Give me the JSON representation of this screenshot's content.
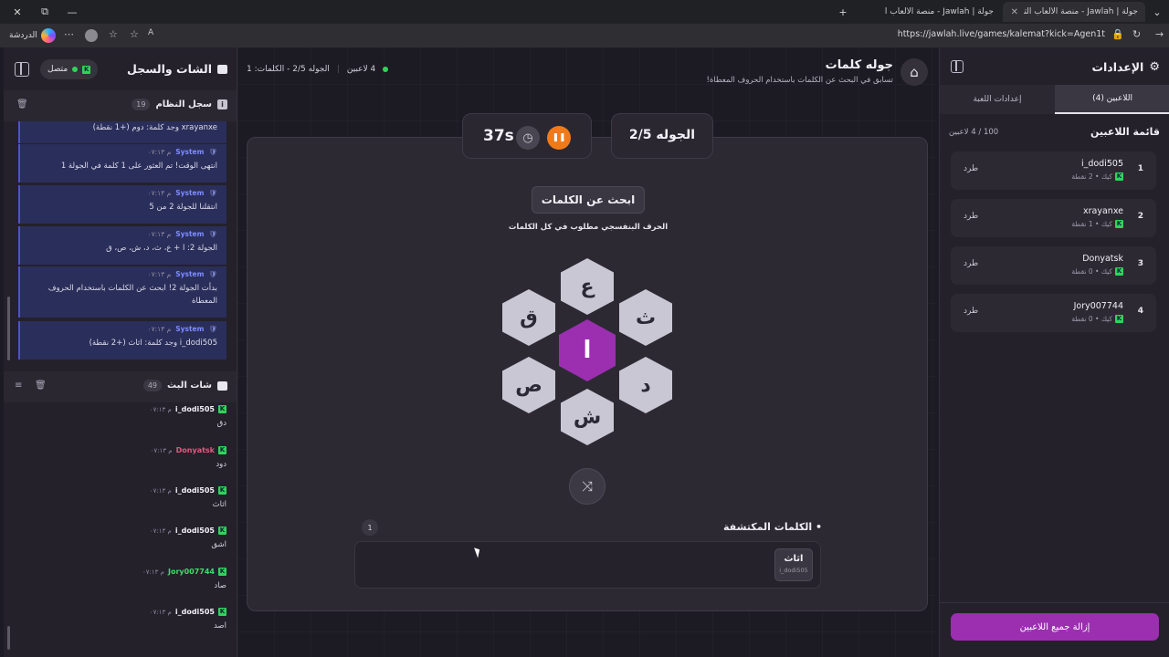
{
  "browser": {
    "tabs": [
      {
        "label": "جولة | Jawlah - منصة الألعاب التفاعلية",
        "active": true
      },
      {
        "label": "جولة | Jawlah - منصة الألعاب التفاعلية",
        "active": false
      }
    ],
    "copilot_label": "الدردشة",
    "url": "https://jawlah.live/games/kalemat?kick=Agen1t"
  },
  "chat_panel": {
    "title": "الشات والسجل",
    "status_label": "متصل",
    "system_log": {
      "title": "سجل النظام",
      "count": "19",
      "first_partial": "xrayanxe وجد كلمة: دوم (+1 نقطة)",
      "messages": [
        {
          "sender": "System",
          "time": "م ٠٧:١٣",
          "text": "انتهى الوقت! تم العثور على 1 كلمة في الجولة 1"
        },
        {
          "sender": "System",
          "time": "م ٠٧:١٣",
          "text": "انتقلنا للجولة 2 من 5"
        },
        {
          "sender": "System",
          "time": "م ٠٧:١٣",
          "text": "الجولة 2: ا + ع، ث، د، ش، ص، ق"
        },
        {
          "sender": "System",
          "time": "م ٠٧:١٣",
          "text": "بدأت الجولة 2! ابحث عن الكلمات باستخدام الحروف المعطاة"
        },
        {
          "sender": "System",
          "time": "م ٠٧:١٣",
          "text": "i_dodi505 وجد كلمة: اثاث (+2 نقطة)"
        }
      ]
    },
    "live_chat": {
      "title": "شات البث",
      "count": "49",
      "messages": [
        {
          "user": "i_dodi505",
          "time": "م ٠٧:١٣",
          "text": "دق",
          "color": "#f0eef6"
        },
        {
          "user": "Donyatsk",
          "time": "م ٠٧:١٣",
          "text": "دود",
          "color": "#e4587e"
        },
        {
          "user": "i_dodi505",
          "time": "م ٠٧:١٣",
          "text": "اثاث",
          "color": "#f0eef6"
        },
        {
          "user": "i_dodi505",
          "time": "م ٠٧:١٣",
          "text": "اشق",
          "color": "#f0eef6"
        },
        {
          "user": "Jory007744",
          "time": "م ٠٧:١٣",
          "text": "صاد",
          "color": "#3ddc6a"
        },
        {
          "user": "i_dodi505",
          "time": "م ٠٧:١٣",
          "text": "اصد",
          "color": "#f0eef6"
        }
      ]
    }
  },
  "header": {
    "title": "جوله كلمات",
    "subtitle": "تسابق في البحث عن الكلمات باستخدام الحروف المعطاة!",
    "players_online": "4 لاعبين",
    "round_info": "الجوله 2/5 - الكلمات: 1"
  },
  "game": {
    "round_label": "الجوله 2/5",
    "timer": "37s",
    "search_title": "ابحث عن الكلمات",
    "hint": "الحرف البنفسجي مطلوب في كل الكلمات",
    "center_letter": "ا",
    "letters": {
      "top": "ع",
      "top_right": "ث",
      "bottom_right": "د",
      "bottom": "ش",
      "bottom_left": "ص",
      "top_left": "ق"
    },
    "found_title": "الكلمات المكتشفة",
    "found_count": "1",
    "found_words": [
      {
        "word": "اثاث",
        "by": "i_dodi505"
      }
    ]
  },
  "settings": {
    "title": "الإعدادات",
    "tabs": {
      "players": "اللاعبين (4)",
      "game": "إعدادات اللعبة"
    },
    "list_title": "قائمة اللاعبين",
    "capacity": "100 / 4 لاعبين",
    "kick_label": "طرد",
    "players": [
      {
        "rank": "1",
        "name": "i_dodi505",
        "sub": "كيك • 2 نقطة"
      },
      {
        "rank": "2",
        "name": "xrayanxe",
        "sub": "كيك • 1 نقطة"
      },
      {
        "rank": "3",
        "name": "Donyatsk",
        "sub": "كيك • 0 نقطة"
      },
      {
        "rank": "4",
        "name": "Jory007744",
        "sub": "كيك • 0 نقطة"
      }
    ],
    "remove_all": "إزالة جميع اللاعبين"
  },
  "colors": {
    "accent": "#9b2fb0",
    "orange": "#f07a1a",
    "green": "#2fd45a",
    "system_blue": "#2a2e5a"
  }
}
